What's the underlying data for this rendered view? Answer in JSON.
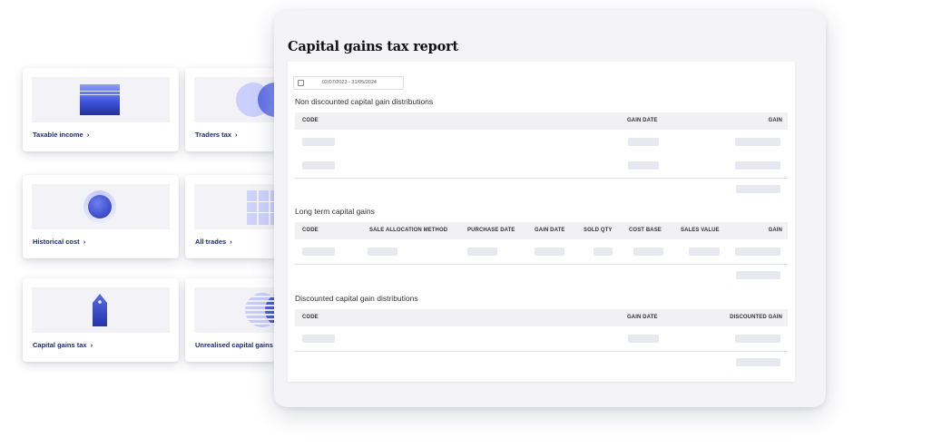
{
  "cards": [
    {
      "label": "Taxable income",
      "icon": "table-chart-icon"
    },
    {
      "label": "Traders tax",
      "icon": "venn-circles-icon"
    },
    {
      "label": "Historical cost",
      "icon": "donut-chart-icon"
    },
    {
      "label": "All trades",
      "icon": "grid-blocks-icon"
    },
    {
      "label": "Capital gains tax",
      "icon": "price-tag-icon"
    },
    {
      "label": "Unrealised capital gains t",
      "icon": "striped-circles-icon"
    }
  ],
  "chevron": "›",
  "report": {
    "title": "Capital gains tax report",
    "date_range": "02/07/2023  -  31/05/2024",
    "sections": [
      {
        "title": "Non discounted capital gain distributions",
        "columns": [
          "CODE",
          "GAIN DATE",
          "GAIN"
        ]
      },
      {
        "title": "Long term capital gains",
        "columns": [
          "CODE",
          "SALE ALLOCATION METHOD",
          "PURCHASE DATE",
          "GAIN DATE",
          "SOLD QTY",
          "COST BASE",
          "SALES VALUE",
          "GAIN"
        ]
      },
      {
        "title": "Discounted capital gain distributions",
        "columns": [
          "CODE",
          "GAIN DATE",
          "DISCOUNTED GAIN"
        ]
      }
    ]
  },
  "colors": {
    "brand": "#1d2a78",
    "accent": "#3b4fd8",
    "panel_bg": "#f4f4f7",
    "skeleton": "#e8e8f0"
  }
}
